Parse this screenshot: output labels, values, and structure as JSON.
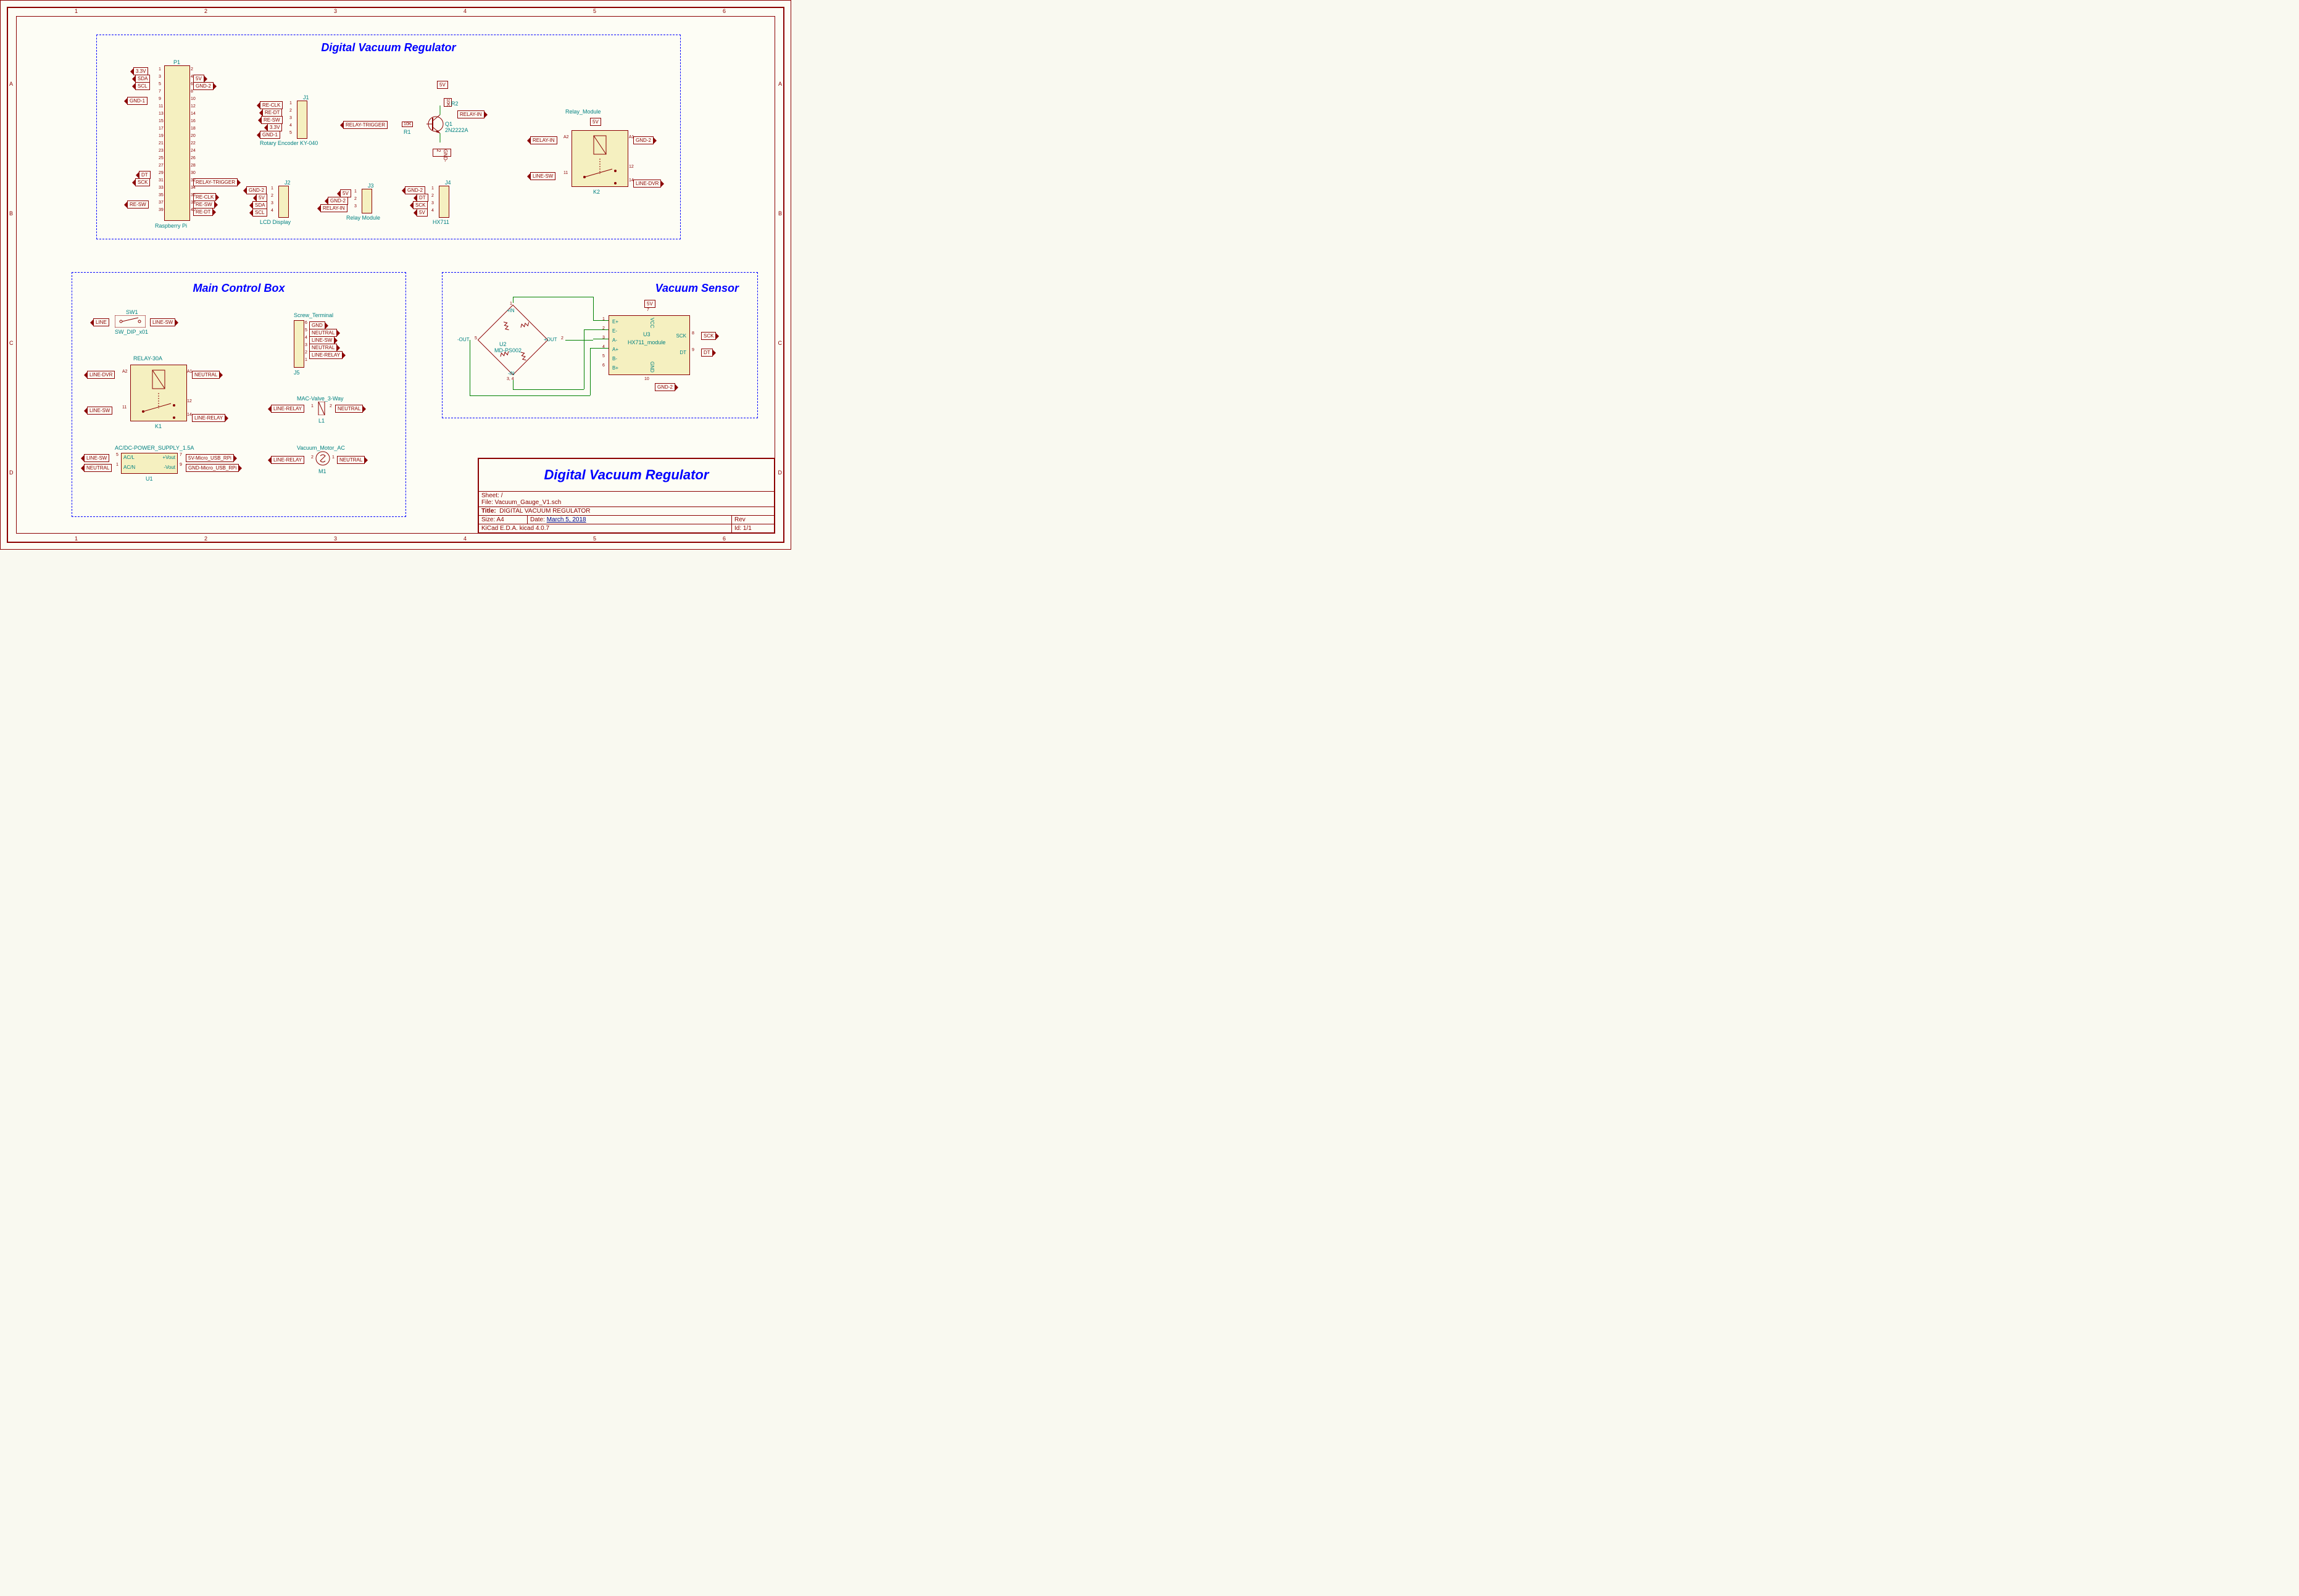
{
  "ruler": {
    "top": [
      "1",
      "2",
      "3",
      "4",
      "5",
      "6"
    ],
    "sides": [
      "A",
      "B",
      "C",
      "D"
    ]
  },
  "blocks": {
    "dvr": {
      "title": "Digital Vacuum Regulator"
    },
    "mcb": {
      "title": "Main Control Box"
    },
    "vs": {
      "title": "Vacuum Sensor"
    }
  },
  "rpi": {
    "ref": "P1",
    "name": "Raspberry Pi",
    "left_pins": [
      "1",
      "3",
      "5",
      "7",
      "9",
      "11",
      "13",
      "15",
      "17",
      "19",
      "21",
      "23",
      "25",
      "27",
      "29",
      "31",
      "33",
      "35",
      "37",
      "39"
    ],
    "right_pins": [
      "2",
      "4",
      "6",
      "8",
      "10",
      "12",
      "14",
      "16",
      "18",
      "20",
      "22",
      "24",
      "26",
      "28",
      "30",
      "32",
      "34",
      "36",
      "38",
      "40"
    ],
    "labels": {
      "3v3": "3.3V",
      "sda": "SDA",
      "scl": "SCL",
      "gnd1": "GND-1",
      "dt": "DT",
      "sck": "SCK",
      "resw": "RE-SW",
      "5v": "5V",
      "gnd2": "GND-2",
      "relaytrig": "RELAY-TRIGGER",
      "reclk": "RE-CLK",
      "resw2": "RE-SW",
      "redt": "RE-DT"
    }
  },
  "encoder": {
    "ref": "J1",
    "name": "Rotary Encoder KY-040",
    "pins": {
      "1": "RE-CLK",
      "2": "RE-DT",
      "3": "RE-SW",
      "4": "3.3V",
      "5": "GND-1"
    }
  },
  "lcd": {
    "ref": "J2",
    "name": "LCD Display",
    "pins": {
      "1": "GND-2",
      "2": "5V",
      "3": "SDA",
      "4": "SCL"
    }
  },
  "j3": {
    "ref": "J3",
    "name": "Relay Module",
    "pins": {
      "1": "5V",
      "2": "GND-2",
      "3": "RELAY-IN"
    }
  },
  "j4": {
    "ref": "J4",
    "name": "HX711",
    "pins": {
      "1": "GND-2",
      "2": "DT",
      "3": "SCK",
      "4": "5V"
    }
  },
  "q1": {
    "ref": "Q1",
    "name": "2N2222A",
    "r1": "10K",
    "r1ref": "R1",
    "r2": "10K",
    "r2ref": "R2",
    "top": "5V",
    "bot": "GND-2",
    "in": "RELAY-TRIGGER",
    "out": "RELAY-IN"
  },
  "k2": {
    "ref": "K2",
    "name": "Relay_Module",
    "top": "5V",
    "a1": "GND-2",
    "a2": "RELAY-IN",
    "p11": "LINE-SW",
    "p12": "",
    "p14": "LINE-DVR"
  },
  "sw1": {
    "ref": "SW1",
    "name": "SW_DIP_x01",
    "l": "LINE",
    "r": "LINE-SW"
  },
  "k1": {
    "ref": "K1",
    "name": "RELAY-30A",
    "a1": "NEUTRAL",
    "a2": "LINE-DVR",
    "p11": "LINE-SW",
    "p12": "",
    "p14": "LINE-RELAY"
  },
  "u1": {
    "ref": "U1",
    "name": "AC/DC-POWER_SUPPLY_1.5A",
    "acL": "LINE-SW",
    "acN": "NEUTRAL",
    "vout": "5V-Micro_USB_RPi",
    "gnd": "GND-Micro_USB_RPi",
    "p_acL": "AC/L",
    "p_acN": "AC/N",
    "p_vout": "+Vout",
    "p_gnd": "-Vout"
  },
  "j5": {
    "ref": "J5",
    "name": "Screw_Terminal",
    "pins": {
      "6": "GND",
      "5": "NEUTRAL",
      "4": "LINE-SW",
      "3": "NEUTRAL",
      "2": "LINE-RELAY",
      "1": ""
    }
  },
  "l1": {
    "ref": "L1",
    "name": "MAC-Valve_3-Way",
    "l": "LINE-RELAY",
    "r": "NEUTRAL"
  },
  "m1": {
    "ref": "M1",
    "name": "Vacuum_Motor_AC",
    "l": "LINE-RELAY",
    "r": "NEUTRAL"
  },
  "u2": {
    "ref": "U2",
    "name": "MD-PS002",
    "p1": "+IN",
    "p2": "+OUT",
    "p3": "-IN",
    "p4": "",
    "p5": "-OUT",
    "p12": "1",
    "p22": "2",
    "p32": "3, 4",
    "p52": "5"
  },
  "u3": {
    "ref": "U3",
    "name": "HX711_module",
    "e+": "E+",
    "e-": "E-",
    "a-": "A-",
    "a+": "A+",
    "b-": "B-",
    "b+": "B+",
    "vcc": "VCC",
    "gnd": "GND",
    "sck": "SCK",
    "dt": "DT",
    "vcc_net": "5V",
    "gnd_net": "GND-2",
    "sck_net": "SCK",
    "dt_net": "DT",
    "pins": {
      "1": "1",
      "2": "2",
      "3": "3",
      "4": "4",
      "5": "5",
      "6": "6",
      "7": "7",
      "8": "8",
      "9": "9",
      "10": "10"
    }
  },
  "tb": {
    "bigtitle": "Digital Vacuum Regulator",
    "sheet": "Sheet: /",
    "file": "File: Vacuum_Gauge_V1.sch",
    "title_lbl": "Title:",
    "title": "DIGITAL VACUUM REGULATOR",
    "size_lbl": "Size: A4",
    "date_lbl": "Date:",
    "date": "March 5, 2018",
    "rev": "Rev",
    "tool": "KiCad E.D.A.  kicad 4.0.7",
    "id": "Id: 1/1"
  }
}
